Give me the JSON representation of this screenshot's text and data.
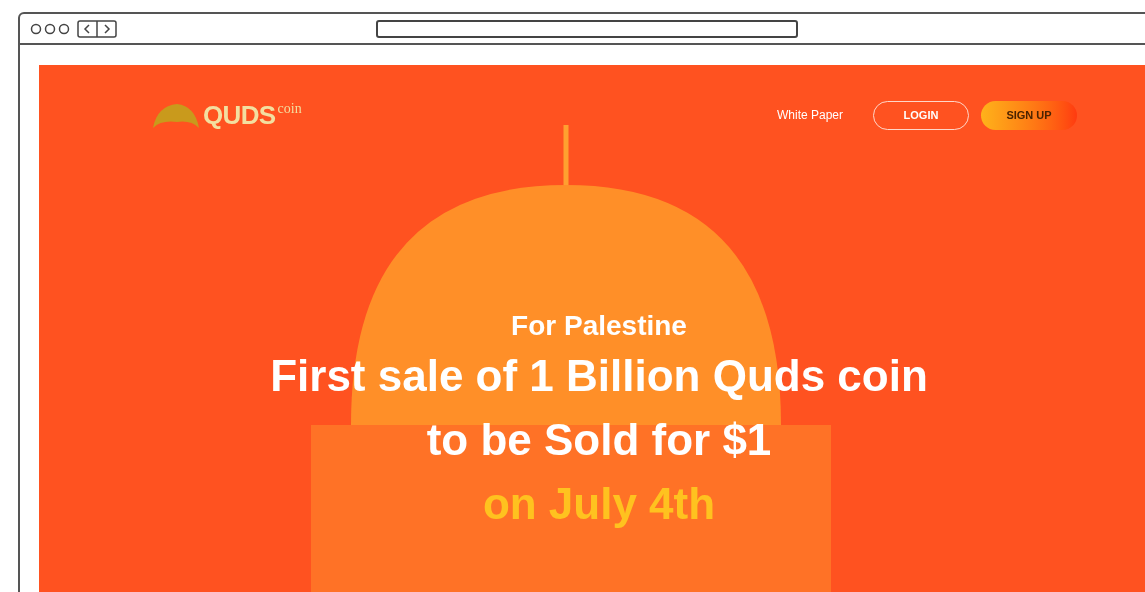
{
  "logo": {
    "name": "QUDS",
    "suffix": "coin"
  },
  "nav": {
    "link": "White Paper",
    "buttons": [
      {
        "label": "LOGIN",
        "kind": "outline"
      },
      {
        "label": "SIGN UP",
        "kind": "gradient"
      }
    ]
  },
  "hero": {
    "kicker": "For Palestine",
    "lines": [
      {
        "text": "First sale of 1 Billion Quds coin",
        "kind": "headline"
      },
      {
        "text": "to be Sold for $1",
        "kind": "headline"
      },
      {
        "text": "on July 4th",
        "kind": "highlight"
      }
    ]
  }
}
